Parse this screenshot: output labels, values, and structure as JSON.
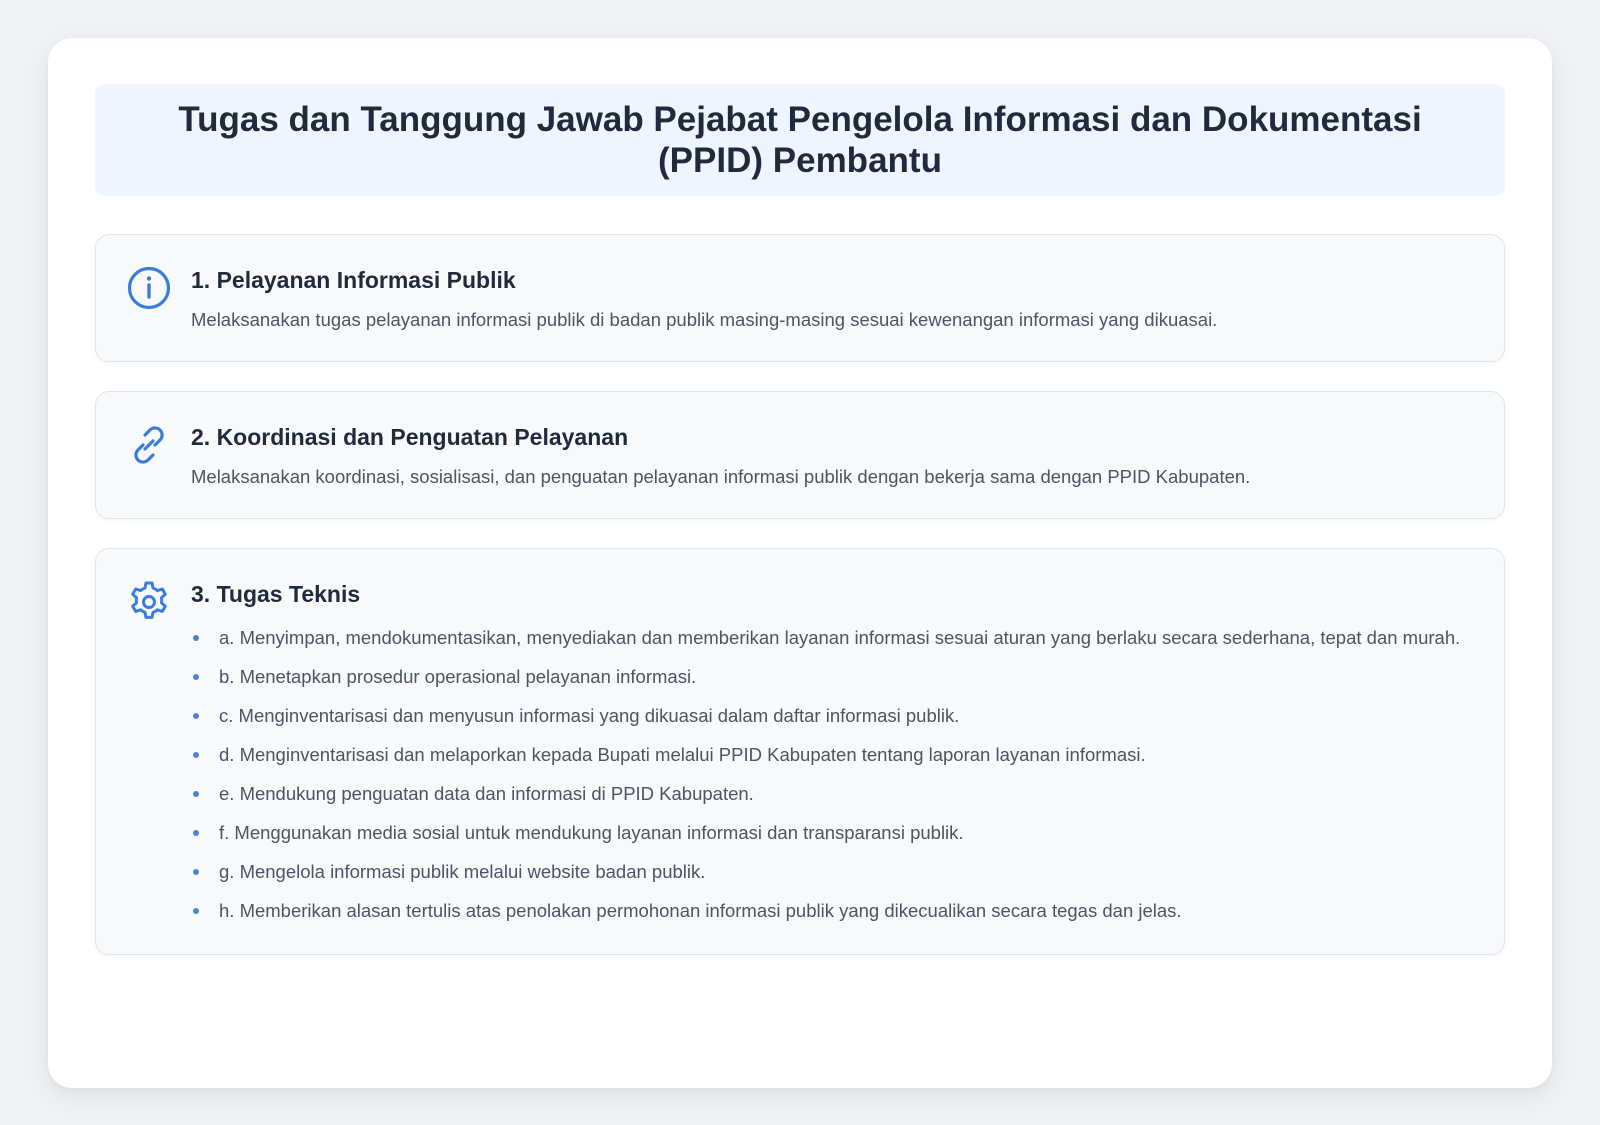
{
  "page": {
    "title": "Tugas dan Tanggung Jawab Pejabat Pengelola Informasi dan Dokumentasi (PPID) Pembantu"
  },
  "colors": {
    "accent": "#3b7ddd",
    "title_bg": "#eef5ff",
    "section_bg": "#f7f9fb",
    "text_dark": "#1f2a3c",
    "text_muted": "#4b5565"
  },
  "sections": [
    {
      "icon": "info-icon",
      "title": "1. Pelayanan Informasi Publik",
      "description": "Melaksanakan tugas pelayanan informasi publik di badan publik masing-masing sesuai kewenangan informasi yang dikuasai."
    },
    {
      "icon": "link-icon",
      "title": "2. Koordinasi dan Penguatan Pelayanan",
      "description": "Melaksanakan koordinasi, sosialisasi, dan penguatan pelayanan informasi publik dengan bekerja sama dengan PPID Kabupaten."
    },
    {
      "icon": "gear-icon",
      "title": "3. Tugas Teknis",
      "items": [
        "a. Menyimpan, mendokumentasikan, menyediakan dan memberikan layanan informasi sesuai aturan yang berlaku secara sederhana, tepat dan murah.",
        "b. Menetapkan prosedur operasional pelayanan informasi.",
        "c. Menginventarisasi dan menyusun informasi yang dikuasai dalam daftar informasi publik.",
        "d. Menginventarisasi dan melaporkan kepada Bupati melalui PPID Kabupaten tentang laporan layanan informasi.",
        "e. Mendukung penguatan data dan informasi di PPID Kabupaten.",
        "f. Menggunakan media sosial untuk mendukung layanan informasi dan transparansi publik.",
        "g. Mengelola informasi publik melalui website badan publik.",
        "h. Memberikan alasan tertulis atas penolakan permohonan informasi publik yang dikecualikan secara tegas dan jelas."
      ]
    }
  ]
}
